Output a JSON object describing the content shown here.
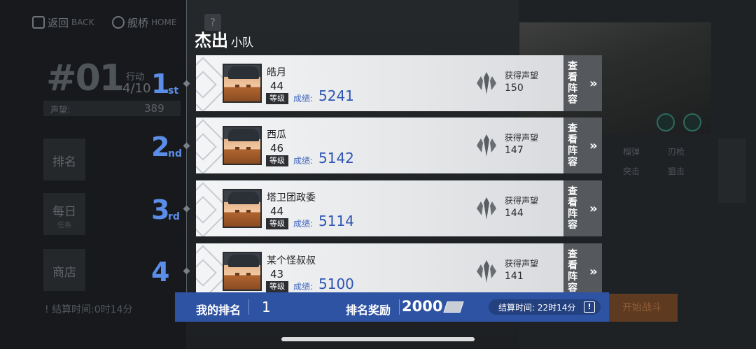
{
  "background": {
    "nav": {
      "back_cn": "返回",
      "back_en": "BACK",
      "home_cn": "舰桥",
      "home_en": "HOME",
      "help": "?"
    },
    "rank_label": "#01",
    "action_label": "行动",
    "action_value": "4/10",
    "prestige_label": "声望:",
    "prestige_value": "389",
    "tabs": [
      {
        "label": "排名",
        "sub": ""
      },
      {
        "label": "每日",
        "sub": "任务"
      },
      {
        "label": "商店",
        "sub": ""
      }
    ],
    "settle_text": "! 结算时间:0时14分",
    "skills": [
      "榴弹",
      "刃枪",
      "突击",
      "狙击"
    ],
    "orange_button": "开始战斗"
  },
  "title": {
    "main": "杰出",
    "sub": "小队"
  },
  "places": [
    {
      "num": "1",
      "suffix": "st"
    },
    {
      "num": "2",
      "suffix": "nd"
    },
    {
      "num": "3",
      "suffix": "rd"
    },
    {
      "num": "4",
      "suffix": ""
    }
  ],
  "rows": [
    {
      "name": "皓月",
      "level": "44",
      "level_tag": "等级",
      "score_label": "成绩:",
      "score": "5241",
      "rep_label": "获得声望",
      "rep": "150",
      "view_label": "查看阵容"
    },
    {
      "name": "西瓜",
      "level": "46",
      "level_tag": "等级",
      "score_label": "成绩:",
      "score": "5142",
      "rep_label": "获得声望",
      "rep": "147",
      "view_label": "查看阵容"
    },
    {
      "name": "塔卫团政委",
      "level": "44",
      "level_tag": "等级",
      "score_label": "成绩:",
      "score": "5114",
      "rep_label": "获得声望",
      "rep": "144",
      "view_label": "查看阵容"
    },
    {
      "name": "某个怪叔叔",
      "level": "43",
      "level_tag": "等级",
      "score_label": "成绩:",
      "score": "5100",
      "rep_label": "获得声望",
      "rep": "141",
      "view_label": "查看阵容"
    }
  ],
  "bottom_bar": {
    "my_rank_label": "我的排名",
    "my_rank": "1",
    "reward_label": "排名奖励",
    "reward": "2000",
    "settle_time": "结算时间: 22时14分",
    "warn": "!"
  },
  "colors": {
    "accent_blue": "#5b8ee8",
    "bar_blue": "#2e53a3",
    "score_blue": "#2f55b4"
  },
  "icons": [
    "back-icon",
    "home-icon",
    "help-icon",
    "prestige-icon",
    "chevron-right-icon",
    "ticket-icon",
    "warning-icon"
  ]
}
